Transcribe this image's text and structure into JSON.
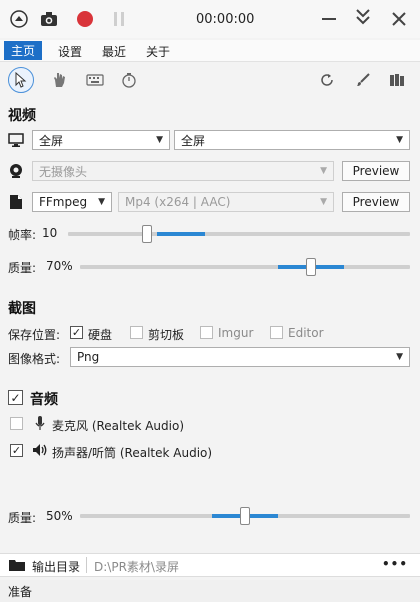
{
  "titlebar": {
    "timer": "00:00:00"
  },
  "menu": {
    "items": [
      "主页",
      "设置",
      "最近",
      "关于"
    ]
  },
  "video": {
    "title": "视频",
    "screen_value": "全屏",
    "screen_value2": "全屏",
    "webcam_value": "无摄像头",
    "webcam_preview": "Preview",
    "encoder_value": "FFmpeg",
    "format_value": "Mp4 (x264 | AAC)",
    "format_preview": "Preview",
    "framerate_label": "帧率:",
    "framerate_value": "10",
    "framerate_level": 0.23,
    "quality_label": "质量:",
    "quality_value": "70%",
    "quality_level": 0.7
  },
  "screenshot": {
    "title": "截图",
    "save_label": "保存位置:",
    "targets": [
      {
        "label": "硬盘",
        "checked": true
      },
      {
        "label": "剪切板",
        "checked": false
      },
      {
        "label": "Imgur",
        "checked": false
      },
      {
        "label": "Editor",
        "checked": false
      }
    ],
    "format_label": "图像格式:",
    "format_value": "Png"
  },
  "audio": {
    "title": "音频",
    "checked": true,
    "mic_label": "麦克风 (Realtek Audio)",
    "mic_checked": false,
    "speaker_label": "扬声器/听筒 (Realtek Audio)",
    "speaker_checked": true,
    "quality_label": "质量:",
    "quality_value": "50%",
    "quality_level": 0.5
  },
  "output": {
    "label": "输出目录",
    "path": "D:\\PR素材\\录屏",
    "more": "•••"
  },
  "status": {
    "text": "准备"
  },
  "colors": {
    "accent": "#1d6fc7",
    "record": "#d9343a",
    "slider_fill": "#2b87d3"
  },
  "icons": [
    "circle-up-icon",
    "camera-icon",
    "record-icon",
    "pause-icon",
    "minimize-icon",
    "collapse-icon",
    "close-icon",
    "cursor-icon",
    "hand-icon",
    "keyboard-icon",
    "timer-icon",
    "refresh-icon",
    "brush-icon",
    "columns-icon",
    "monitor-icon",
    "webcam-icon",
    "file-icon",
    "microphone-icon",
    "speaker-icon",
    "folder-icon"
  ]
}
